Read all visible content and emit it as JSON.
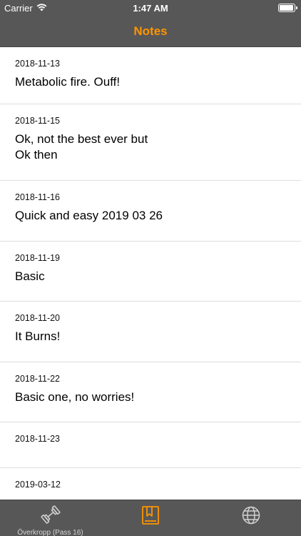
{
  "status_bar": {
    "carrier": "Carrier",
    "time": "1:47 AM",
    "battery_level": 0.95
  },
  "nav": {
    "title": "Notes"
  },
  "notes": [
    {
      "date": "2018-11-13",
      "text": "Metabolic fire. Ouff!"
    },
    {
      "date": "2018-11-15",
      "text": "Ok, not the best ever but\nOk then"
    },
    {
      "date": "2018-11-16",
      "text": "Quick and easy 2019 03 26"
    },
    {
      "date": "2018-11-19",
      "text": "Basic"
    },
    {
      "date": "2018-11-20",
      "text": "It Burns!"
    },
    {
      "date": "2018-11-22",
      "text": "Basic one, no worries!"
    },
    {
      "date": "2018-11-23",
      "text": ""
    },
    {
      "date": "2019-03-12",
      "text": ""
    }
  ],
  "tab_bar": {
    "tabs": [
      {
        "icon": "dumbbell-icon",
        "label": "Överkropp (Pass 16)",
        "selected": false
      },
      {
        "icon": "notes-bookmark-icon",
        "label": "",
        "selected": true
      },
      {
        "icon": "globe-icon",
        "label": "",
        "selected": false
      }
    ]
  },
  "colors": {
    "accent": "#ff9500",
    "bar_background": "#575757",
    "inactive_icon": "#d0d0d0"
  }
}
